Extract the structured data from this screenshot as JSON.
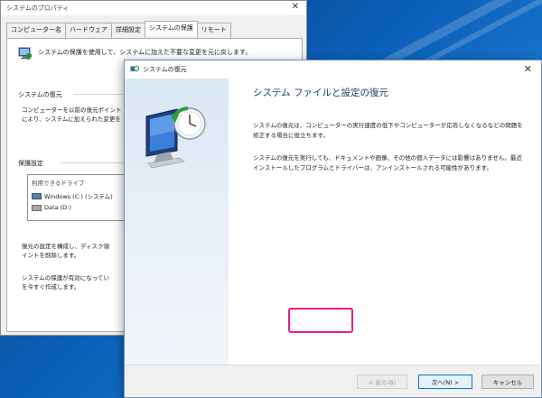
{
  "back_window": {
    "title": "システムのプロパティ",
    "close_glyph": "✕",
    "tabs": [
      {
        "label": "コンピューター名"
      },
      {
        "label": "ハードウェア"
      },
      {
        "label": "詳細設定"
      },
      {
        "label": "システムの保護"
      },
      {
        "label": "リモート"
      }
    ],
    "description": "システムの保護を使用して、システムに加えた不要な変更を元に戻します。",
    "restore_group": "システムの復元",
    "restore_text": "コンピューターを以前の復元ポイント\nにより、システムに加えられた変更を",
    "protection_group": "保護設定",
    "drive_header": "利用できるドライブ",
    "drives": [
      {
        "label": "Windows (C:) (システム)",
        "icon": "os-drive-icon"
      },
      {
        "label": "Data (D:)",
        "icon": "drive-icon"
      }
    ],
    "config_text": "復元の設定を構成し、ディスク領\nイントを削除します。",
    "create_text": "システムの保護が有効になってい\nを今すぐ作成します。"
  },
  "wizard": {
    "title": "システムの復元",
    "close_glyph": "✕",
    "heading": "システム ファイルと設定の復元",
    "para1": "システムの復元は、コンピューターの実行速度の低下やコンピューターが応答しなくなるなどの問題を修正する場合に役立ちます。",
    "para2": "システムの復元を実行しても、ドキュメントや画像、その他の個人データには影響はありません。最近インストールしたプログラムとドライバーは、アンインストールされる可能性があります。",
    "back_button": "< 戻る(B)",
    "next_button": "次へ(N) >",
    "cancel_button": "キャンセル",
    "highlight_color": "#e81e8c"
  }
}
